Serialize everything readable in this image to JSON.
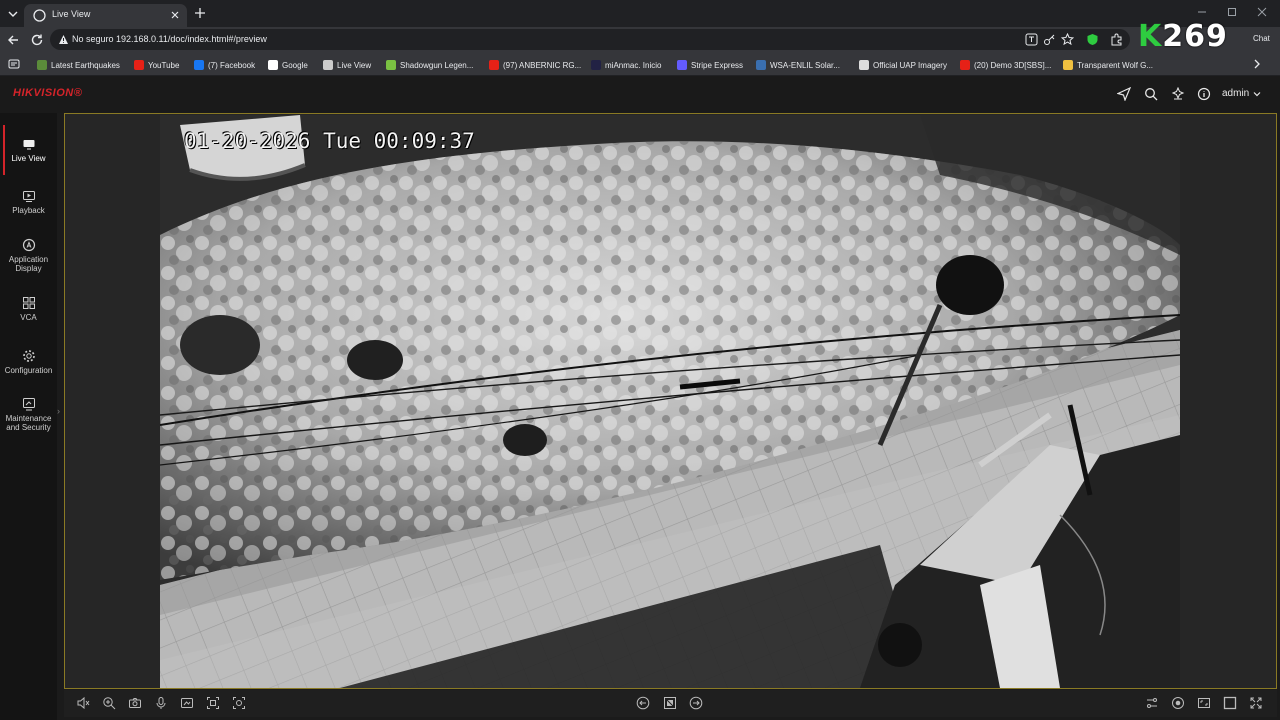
{
  "browser": {
    "tab_title": "Live View",
    "security_label": "No seguro",
    "url": "192.168.0.11/doc/index.html#/preview",
    "chat_label": "Chat",
    "overlay_brand": {
      "prefix": "K",
      "rest": "269"
    }
  },
  "bookmarks": [
    {
      "label": "Latest Earthquakes",
      "icon_color": "#5b8c3a"
    },
    {
      "label": "YouTube",
      "icon_color": "#e62117"
    },
    {
      "label": "(7) Facebook",
      "icon_color": "#1877f2"
    },
    {
      "label": "Google",
      "icon_color": "#ffffff"
    },
    {
      "label": "Live View",
      "icon_color": "#cccccc"
    },
    {
      "label": "Shadowgun Legen...",
      "icon_color": "#7ac142"
    },
    {
      "label": "(97) ANBERNIC RG...",
      "icon_color": "#e62117"
    },
    {
      "label": "miAnmac. Inicio",
      "icon_color": "#222244"
    },
    {
      "label": "Stripe Express",
      "icon_color": "#635bff"
    },
    {
      "label": "WSA-ENLIL Solar...",
      "icon_color": "#3a6fb0"
    },
    {
      "label": "Official UAP Imagery",
      "icon_color": "#dddddd"
    },
    {
      "label": "(20) Demo 3D[SBS]...",
      "icon_color": "#e62117"
    },
    {
      "label": "Transparent Wolf G...",
      "icon_color": "#f0c040"
    }
  ],
  "app": {
    "logo": "HIKVISION®",
    "user": "admin",
    "brand_color": "#d4242a"
  },
  "nav": [
    {
      "label": "Live View",
      "icon": "monitor-icon",
      "active": true
    },
    {
      "label": "Playback",
      "icon": "play-icon",
      "active": false
    },
    {
      "label": "Application Display",
      "icon": "app-display-icon",
      "active": false
    },
    {
      "label": "VCA",
      "icon": "vca-grid-icon",
      "active": false
    },
    {
      "label": "Configuration",
      "icon": "gear-icon",
      "active": false
    },
    {
      "label": "Maintenance and Security",
      "icon": "maintenance-icon",
      "active": false
    }
  ],
  "feed": {
    "osd_timestamp": "01-20-2026 Tue 00:09:37"
  }
}
